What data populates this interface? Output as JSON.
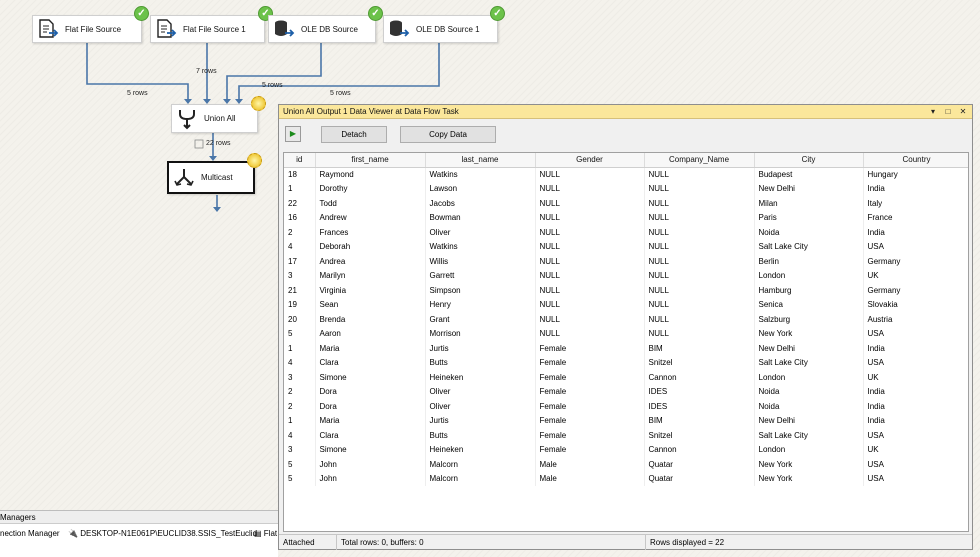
{
  "sources": [
    {
      "label": "Flat File Source"
    },
    {
      "label": "Flat File Source 1"
    },
    {
      "label": "OLE DB Source"
    },
    {
      "label": "OLE DB Source 1"
    }
  ],
  "transforms": {
    "union_all": {
      "label": "Union All"
    },
    "multicast": {
      "label": "Multicast"
    }
  },
  "flow_labels": {
    "src1_rows": "5 rows",
    "src2_rows": "7 rows",
    "src3_rows": "5 rows",
    "src4_rows": "5 rows",
    "union_rows": "22 rows"
  },
  "viewer": {
    "title": "Union All Output 1 Data Viewer at Data Flow Task",
    "detach_label": "Detach",
    "copy_label": "Copy Data",
    "columns": [
      "id",
      "first_name",
      "last_name",
      "Gender",
      "Company_Name",
      "City",
      "Country"
    ],
    "rows": [
      [
        "18",
        "Raymond",
        "Watkins",
        "NULL",
        "NULL",
        "Budapest",
        "Hungary"
      ],
      [
        "1",
        "Dorothy",
        "Lawson",
        "NULL",
        "NULL",
        "New Delhi",
        "India"
      ],
      [
        "22",
        "Todd",
        "Jacobs",
        "NULL",
        "NULL",
        "Milan",
        "Italy"
      ],
      [
        "16",
        "Andrew",
        "Bowman",
        "NULL",
        "NULL",
        "Paris",
        "France"
      ],
      [
        "2",
        "Frances",
        "Oliver",
        "NULL",
        "NULL",
        "Noida",
        "India"
      ],
      [
        "4",
        "Deborah",
        "Watkins",
        "NULL",
        "NULL",
        "Salt Lake City",
        "USA"
      ],
      [
        "17",
        "Andrea",
        "Willis",
        "NULL",
        "NULL",
        "Berlin",
        "Germany"
      ],
      [
        "3",
        "Marilyn",
        "Garrett",
        "NULL",
        "NULL",
        "London",
        "UK"
      ],
      [
        "21",
        "Virginia",
        "Simpson",
        "NULL",
        "NULL",
        "Hamburg",
        "Germany"
      ],
      [
        "19",
        "Sean",
        "Henry",
        "NULL",
        "NULL",
        "Senica",
        "Slovakia"
      ],
      [
        "20",
        "Brenda",
        "Grant",
        "NULL",
        "NULL",
        "Salzburg",
        "Austria"
      ],
      [
        "5",
        "Aaron",
        "Morrison",
        "NULL",
        "NULL",
        "New York",
        "USA"
      ],
      [
        "1",
        "Maria",
        "Jurtis",
        "Female",
        "BIM",
        "New Delhi",
        "India"
      ],
      [
        "4",
        "Clara",
        "Butts",
        "Female",
        "Snitzel",
        "Salt Lake City",
        "USA"
      ],
      [
        "3",
        "Simone",
        "Heineken",
        "Female",
        "Cannon",
        "London",
        "UK"
      ],
      [
        "2",
        "Dora",
        "Oliver",
        "Female",
        "IDES",
        "Noida",
        "India"
      ],
      [
        "2",
        "Dora",
        "Oliver",
        "Female",
        "IDES",
        "Noida",
        "India"
      ],
      [
        "1",
        "Maria",
        "Jurtis",
        "Female",
        "BIM",
        "New Delhi",
        "India"
      ],
      [
        "4",
        "Clara",
        "Butts",
        "Female",
        "Snitzel",
        "Salt Lake City",
        "USA"
      ],
      [
        "3",
        "Simone",
        "Heineken",
        "Female",
        "Cannon",
        "London",
        "UK"
      ],
      [
        "5",
        "John",
        "Malcorn",
        "Male",
        "Quatar",
        "New York",
        "USA"
      ],
      [
        "5",
        "John",
        "Malcorn",
        "Male",
        "Quatar",
        "New York",
        "USA"
      ]
    ],
    "status": {
      "attached": "Attached",
      "total": "Total rows: 0, buffers: 0",
      "displayed": "Rows displayed = 22"
    }
  },
  "bottom": {
    "tab_label": "Managers",
    "connection_manager": "nection Manager",
    "connection_1": "DESKTOP-N1E061P\\EUCLID38.SSIS_TestEuclid",
    "connection_2": "Flat"
  },
  "colors": {
    "title_bar": "#fbe79b",
    "flow_line": "#4a76a8",
    "check": "#6cc24a"
  },
  "icons": {
    "flat_file": "document-arrow-icon",
    "ole_db": "database-arrow-icon",
    "union": "merge-arrows-icon",
    "multicast": "split-arrows-icon",
    "ok": "green-check-icon",
    "warn": "yellow-sun-icon"
  }
}
